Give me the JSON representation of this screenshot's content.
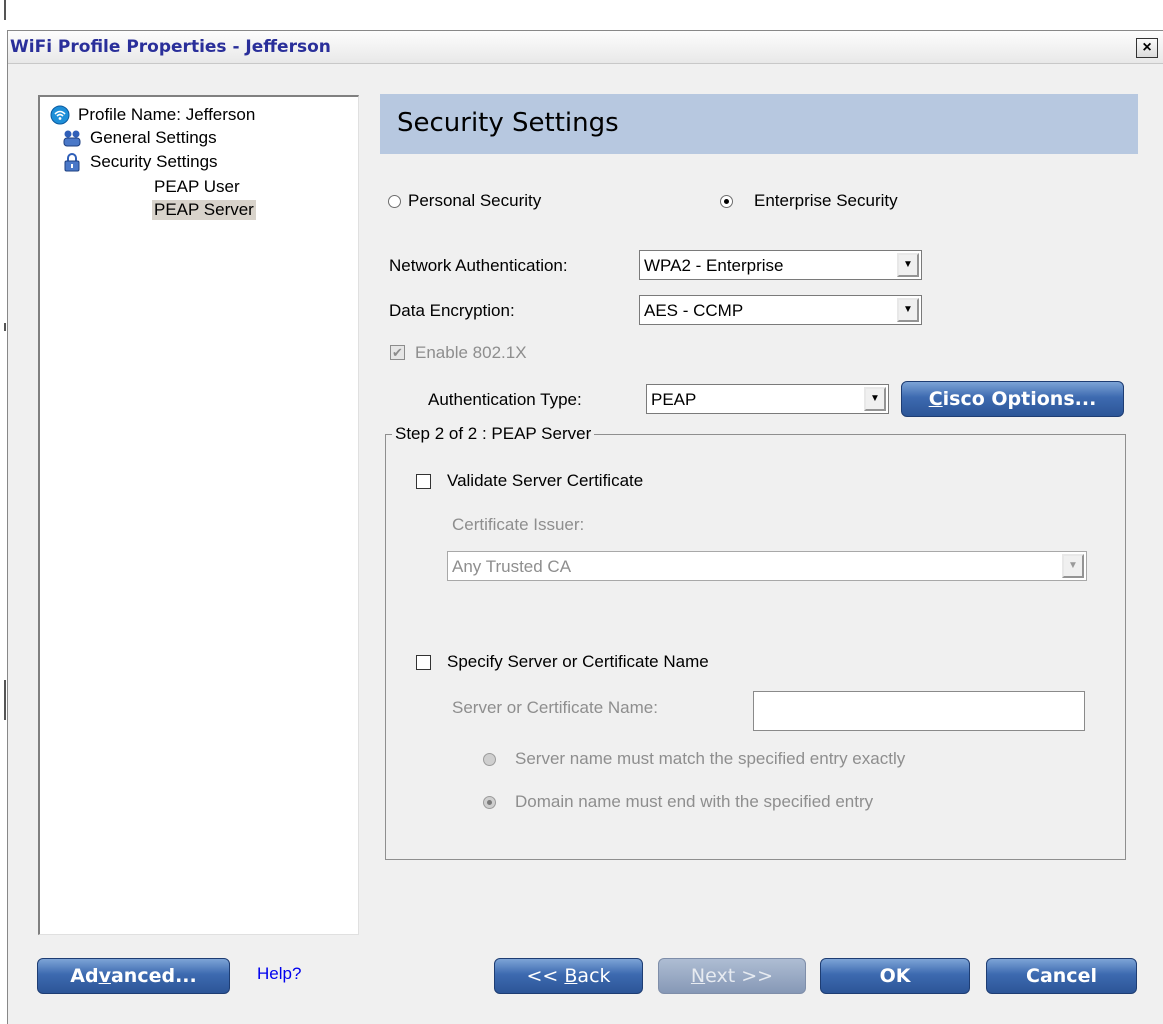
{
  "window": {
    "title": "WiFi Profile Properties - Jefferson",
    "close_glyph": "×"
  },
  "tree": {
    "root": "Profile Name: Jefferson",
    "items": [
      "General Settings",
      "Security Settings",
      "PEAP User",
      "PEAP Server"
    ],
    "selected": "PEAP Server"
  },
  "header": {
    "title": "Security Settings"
  },
  "security_mode": {
    "personal_label": "Personal Security",
    "enterprise_label": "Enterprise Security",
    "selected": "Enterprise Security"
  },
  "network_auth": {
    "label": "Network Authentication:",
    "value": "WPA2 - Enterprise"
  },
  "data_encryption": {
    "label": "Data Encryption:",
    "value": "AES - CCMP"
  },
  "enable_8021x": {
    "label": "Enable 802.1X",
    "checked": true,
    "disabled": true
  },
  "auth_type": {
    "label": "Authentication Type:",
    "value": "PEAP"
  },
  "cisco_button": {
    "prefix": "C",
    "rest": "isco Options..."
  },
  "group": {
    "title": "Step 2 of 2 : PEAP Server",
    "validate_cert": {
      "label": "Validate Server Certificate",
      "checked": false
    },
    "issuer_label": "Certificate Issuer:",
    "issuer_value": "Any Trusted CA",
    "specify_name": {
      "label": "Specify Server or Certificate Name",
      "checked": false
    },
    "server_name_label": "Server or Certificate Name:",
    "server_name_value": "",
    "match_exact_label": "Server name must match the specified entry exactly",
    "domain_end_label": "Domain name must end with the specified entry",
    "match_selected": "domain"
  },
  "footer": {
    "advanced_pre": "Ad",
    "advanced_key": "v",
    "advanced_post": "anced...",
    "help": "Help?",
    "back_pre": "<< ",
    "back_key": "B",
    "back_post": "ack",
    "next_key": "N",
    "next_post": "ext >>",
    "ok": "OK",
    "cancel": "Cancel"
  },
  "colors": {
    "title_text": "#2a2f9a",
    "header_band": "#b7c8e0",
    "button_blue": "#3d6ab0"
  }
}
